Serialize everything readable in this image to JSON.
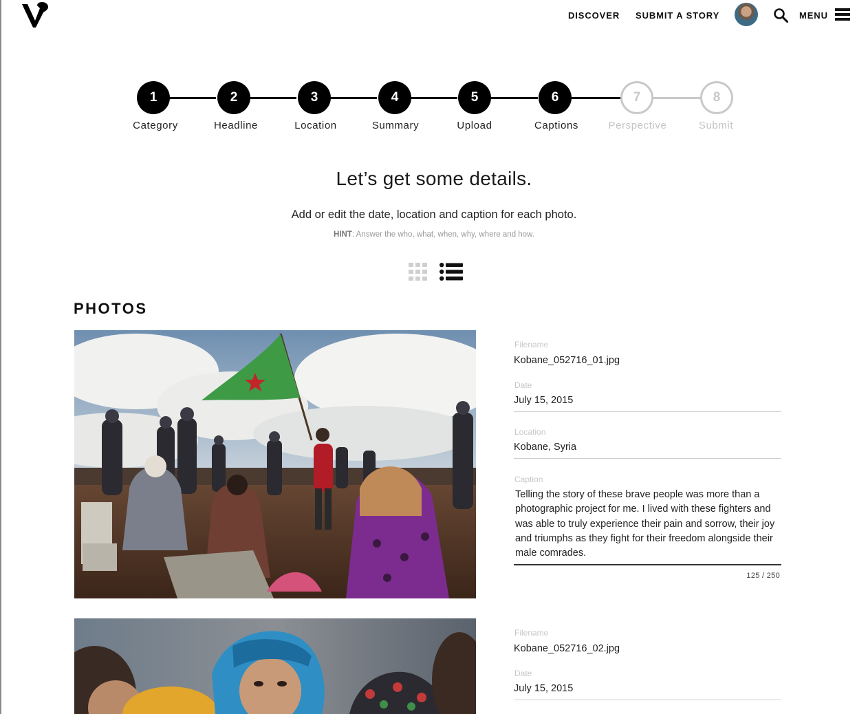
{
  "header": {
    "nav": [
      {
        "label": "DISCOVER"
      },
      {
        "label": "SUBMIT A STORY"
      }
    ],
    "menu_label": "MENU"
  },
  "stepper": {
    "steps": [
      {
        "number": "1",
        "label": "Category",
        "state": "done"
      },
      {
        "number": "2",
        "label": "Headline",
        "state": "done"
      },
      {
        "number": "3",
        "label": "Location",
        "state": "done"
      },
      {
        "number": "4",
        "label": "Summary",
        "state": "done"
      },
      {
        "number": "5",
        "label": "Upload",
        "state": "done"
      },
      {
        "number": "6",
        "label": "Captions",
        "state": "current"
      },
      {
        "number": "7",
        "label": "Perspective",
        "state": "todo"
      },
      {
        "number": "8",
        "label": "Submit",
        "state": "todo"
      }
    ]
  },
  "intro": {
    "headline": "Let’s get some details.",
    "subline": "Add or edit the date, location and caption for each photo.",
    "hint_label": "HINT",
    "hint_text": ": Answer the who, what, when, why, where and how."
  },
  "view_toggle": {
    "active": "list"
  },
  "photos_section": {
    "title": "PHOTOS",
    "items": [
      {
        "filename_label": "Filename",
        "filename": "Kobane_052716_01.jpg",
        "date_label": "Date",
        "date": "July 15, 2015",
        "location_label": "Location",
        "location": "Kobane, Syria",
        "caption_label": "Caption",
        "caption": "Telling the story of these brave people was more than a photographic project for me. I lived with these fighters and was able to truly experience their pain and sorrow, their joy and triumphs as they fight for their freedom alongside their male comrades.",
        "counter": "125 / 250"
      },
      {
        "filename_label": "Filename",
        "filename": "Kobane_052716_02.jpg",
        "date_label": "Date",
        "date": "July 15, 2015"
      }
    ]
  },
  "colors": {
    "accent": "#000000",
    "inactive_step": "#c9c9c9",
    "flag_green": "#3f9a45",
    "flag_star": "#c0262a"
  }
}
